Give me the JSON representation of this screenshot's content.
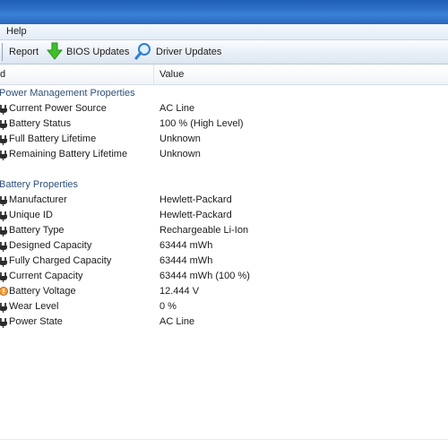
{
  "menu": {
    "help": "Help"
  },
  "toolbar": {
    "report": "Report",
    "bios": "BIOS Updates",
    "driver": "Driver Updates"
  },
  "columns": {
    "field": "d",
    "value": "Value"
  },
  "groups": [
    {
      "title": "Power Management Properties",
      "rows": [
        {
          "name": "Current Power Source",
          "value": "AC Line",
          "icon": "plug-icon"
        },
        {
          "name": "Battery Status",
          "value": "100 % (High Level)",
          "icon": "plug-icon"
        },
        {
          "name": "Full Battery Lifetime",
          "value": "Unknown",
          "icon": "plug-icon"
        },
        {
          "name": "Remaining Battery Lifetime",
          "value": "Unknown",
          "icon": "plug-icon"
        }
      ]
    },
    {
      "title": "Battery Properties",
      "rows": [
        {
          "name": "Manufacturer",
          "value": "Hewlett-Packard",
          "icon": "plug-icon"
        },
        {
          "name": "Unique ID",
          "value": "Hewlett-Packard",
          "icon": "plug-icon"
        },
        {
          "name": "Battery Type",
          "value": "Rechargeable Li-Ion",
          "icon": "plug-icon"
        },
        {
          "name": "Designed Capacity",
          "value": "63444 mWh",
          "icon": "plug-icon"
        },
        {
          "name": "Fully Charged Capacity",
          "value": "63444 mWh",
          "icon": "plug-icon"
        },
        {
          "name": "Current Capacity",
          "value": "63444 mWh  (100 %)",
          "icon": "plug-icon"
        },
        {
          "name": "Battery Voltage",
          "value": "12.444 V",
          "icon": "warning-icon"
        },
        {
          "name": "Wear Level",
          "value": "0 %",
          "icon": "plug-icon"
        },
        {
          "name": "Power State",
          "value": "AC Line",
          "icon": "plug-icon"
        }
      ]
    }
  ]
}
